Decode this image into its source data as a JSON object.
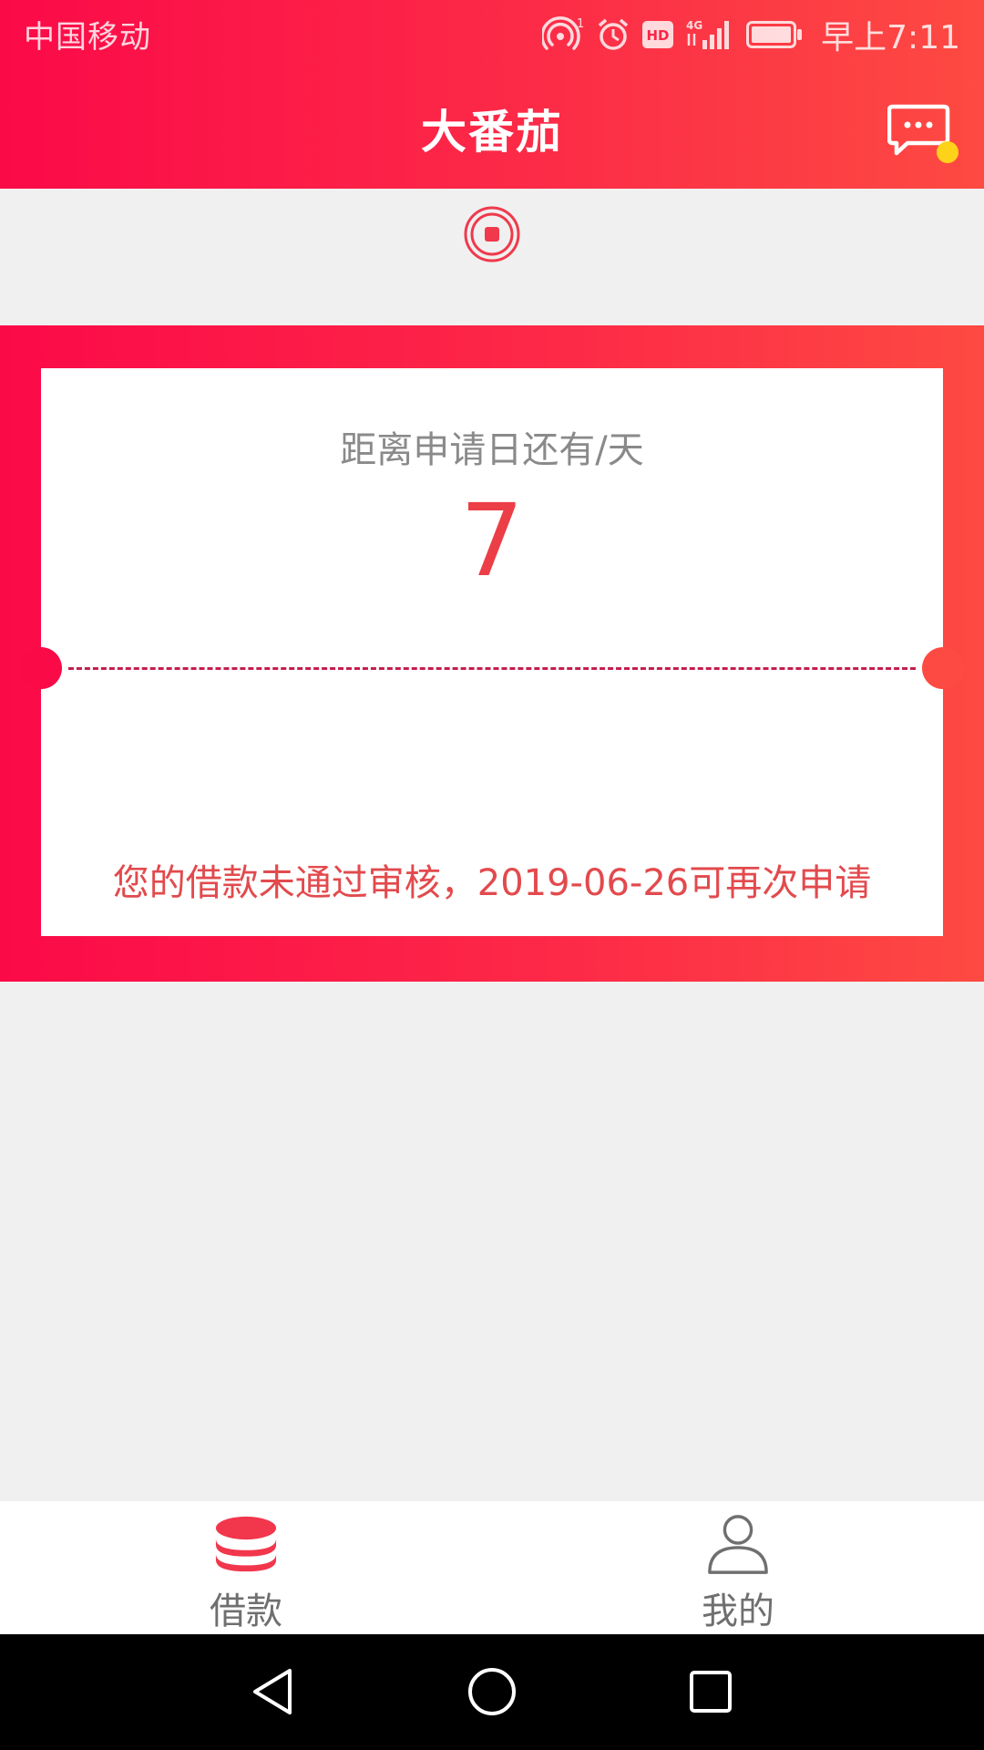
{
  "status_bar": {
    "carrier": "中国移动",
    "time": "早上7:11",
    "hd_badge": "HD",
    "network": "4G",
    "hotspot_count": "1",
    "icons": [
      "hotspot-icon",
      "alarm-icon",
      "hd-icon",
      "signal-icon",
      "battery-icon"
    ]
  },
  "header": {
    "title": "大番茄",
    "message_icon": "message-icon",
    "message_has_unread": true
  },
  "countdown_card": {
    "label": "距离申请日还有/天",
    "days": "7",
    "notice": "您的借款未通过审核，2019-06-26可再次申请"
  },
  "tabs": [
    {
      "label": "借款",
      "icon": "coins-stack-icon",
      "active": true
    },
    {
      "label": "我的",
      "icon": "user-icon",
      "active": false
    }
  ],
  "nav_bar": {
    "icons": [
      "back-icon",
      "home-icon",
      "recents-icon"
    ]
  },
  "colors": {
    "brand_red": "#fb2b47",
    "notice_red": "#e24a4d",
    "unread_dot": "#ffd21a",
    "page_bg": "#f0f0f0"
  }
}
